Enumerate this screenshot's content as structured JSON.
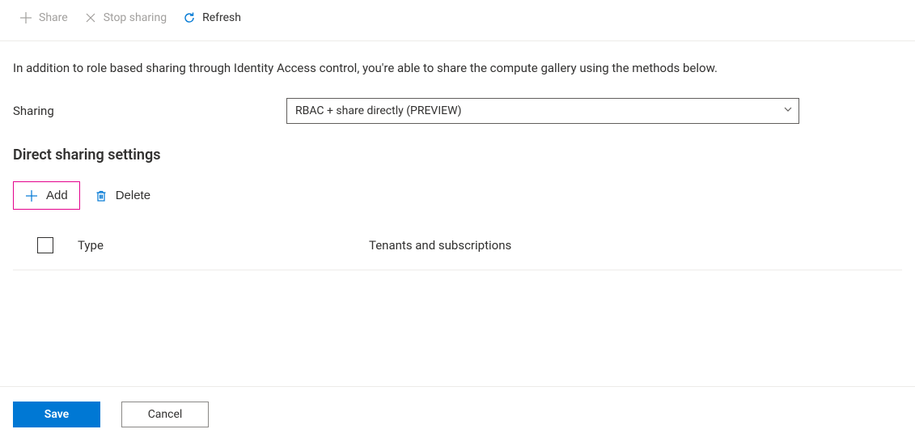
{
  "toolbar": {
    "share_label": "Share",
    "stop_sharing_label": "Stop sharing",
    "refresh_label": "Refresh"
  },
  "description": "In addition to role based sharing through Identity Access control, you're able to share the compute gallery using the methods below.",
  "form": {
    "sharing_label": "Sharing",
    "sharing_value": "RBAC + share directly (PREVIEW)"
  },
  "section": {
    "heading": "Direct sharing settings",
    "add_label": "Add",
    "delete_label": "Delete"
  },
  "table": {
    "columns": {
      "type": "Type",
      "tenants": "Tenants and subscriptions"
    }
  },
  "footer": {
    "save_label": "Save",
    "cancel_label": "Cancel"
  },
  "colors": {
    "accent": "#0078d4",
    "highlight_border": "#e3008c"
  }
}
